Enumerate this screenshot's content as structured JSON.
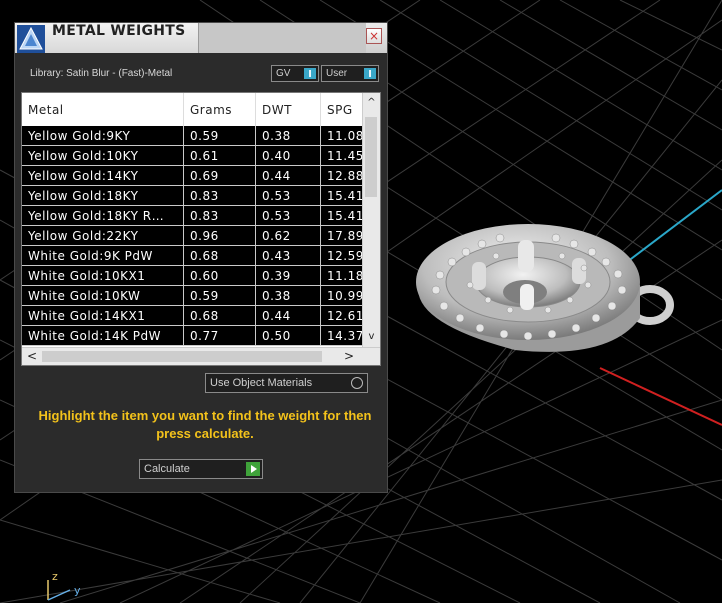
{
  "panel": {
    "title": "METAL WEIGHTS",
    "close": "×",
    "library_label": "Library: Satin Blur - (Fast)-Metal",
    "toggles": {
      "gv": "GV",
      "user": "User"
    },
    "table": {
      "headers": [
        "Metal",
        "Grams",
        "DWT",
        "SPG"
      ],
      "rows": [
        [
          "Yellow Gold:9KY",
          "0.59",
          "0.38",
          "11.08"
        ],
        [
          "Yellow Gold:10KY",
          "0.61",
          "0.40",
          "11.45"
        ],
        [
          "Yellow Gold:14KY",
          "0.69",
          "0.44",
          "12.88"
        ],
        [
          "Yellow Gold:18KY",
          "0.83",
          "0.53",
          "15.41"
        ],
        [
          "Yellow Gold:18KY R…",
          "0.83",
          "0.53",
          "15.41"
        ],
        [
          "Yellow Gold:22KY",
          "0.96",
          "0.62",
          "17.89"
        ],
        [
          "White Gold:9K PdW",
          "0.68",
          "0.43",
          "12.59"
        ],
        [
          "White Gold:10KX1",
          "0.60",
          "0.39",
          "11.18"
        ],
        [
          "White Gold:10KW",
          "0.59",
          "0.38",
          "10.99"
        ],
        [
          "White Gold:14KX1",
          "0.68",
          "0.44",
          "12.61"
        ],
        [
          "White Gold:14K PdW",
          "0.77",
          "0.50",
          "14.37"
        ]
      ]
    },
    "scroll": {
      "up": "^",
      "down": "v",
      "left": "<",
      "right": ">"
    },
    "use_object_materials": "Use Object Materials",
    "hint": "Highlight the item you want to find the weight for then press calculate.",
    "calculate_label": "Calculate"
  },
  "viewport": {
    "axis_z": "z",
    "axis_y": "y",
    "axis_colors": {
      "x": "#d02020",
      "y": "#2aa7c9",
      "z": "#e7c86a"
    }
  }
}
